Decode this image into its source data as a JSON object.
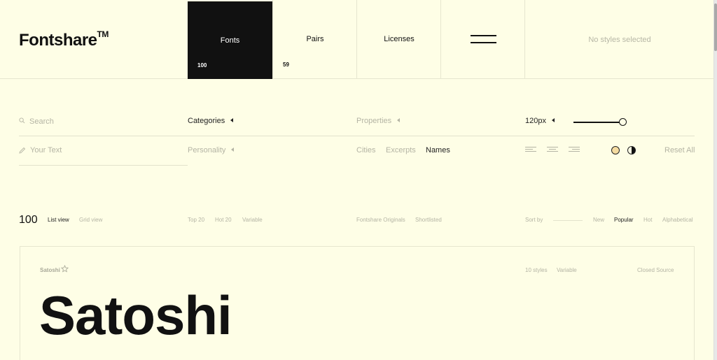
{
  "header": {
    "logo": "Fontshare",
    "logo_mark": "TM",
    "nav": {
      "fonts_label": "Fonts",
      "fonts_count": "100",
      "pairs_label": "Pairs",
      "pairs_count": "59",
      "licenses_label": "Licenses",
      "styles_status": "No styles selected"
    }
  },
  "filters": {
    "search_placeholder": "Search",
    "categories_label": "Categories",
    "properties_label": "Properties",
    "size_value": "120px",
    "size_slider_fraction": 1.0,
    "your_text_placeholder": "Your Text",
    "personality_label": "Personality",
    "text_modes": [
      "Cities",
      "Excerpts",
      "Names"
    ],
    "active_text_mode": "Names",
    "reset_label": "Reset All"
  },
  "toolbar": {
    "count": "100",
    "list_view": "List view",
    "grid_view": "Grid view",
    "quick_filters": [
      "Top 20",
      "Hot 20",
      "Variable"
    ],
    "source_filters": [
      "Fontshare Originals",
      "Shortlisted"
    ],
    "sort_label": "Sort by",
    "sort_options": [
      "New",
      "Popular",
      "Hot",
      "Alphabetical"
    ],
    "active_sort": "Popular"
  },
  "card": {
    "font_name": "Satoshi",
    "styles": "10 styles",
    "variable": "Variable",
    "license": "Closed Source",
    "preview_text": "Satoshi"
  },
  "colors": {
    "background": "#fefee6",
    "ink": "#111111",
    "muted": "#b4b4a4",
    "accent_dot": "#f4dba0"
  }
}
